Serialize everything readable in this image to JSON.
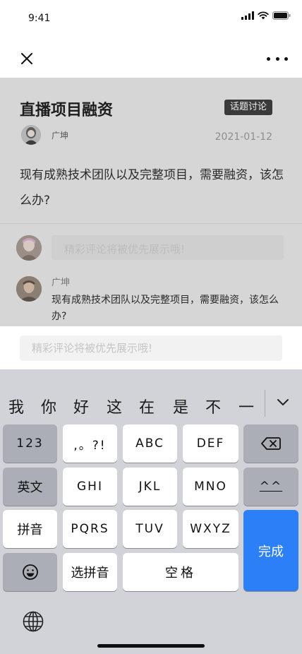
{
  "status_bar": {
    "time": "9:41"
  },
  "post": {
    "title": "直播项目融资",
    "tag": "话题讨论",
    "author": "广坤",
    "date": "2021-01-12",
    "body": "现有成熟技术团队以及完整项目，需要融资，该怎么办?"
  },
  "comments": {
    "input_placeholder": "精彩评论将被优先展示哦!",
    "items": [
      {
        "author": "广坤",
        "text": "现有成熟技术团队以及完整项目，需要融资，该怎么办?"
      }
    ]
  },
  "comment_input": {
    "placeholder": "精彩评论将被优先展示哦!"
  },
  "keyboard": {
    "candidates": [
      "我",
      "你",
      "好",
      "这",
      "在",
      "是",
      "不",
      "一"
    ],
    "keys": {
      "num": "123",
      "punct": ",。?!",
      "abc": "ABC",
      "def": "DEF",
      "english": "英文",
      "ghi": "GHI",
      "jkl": "JKL",
      "mno": "MNO",
      "caret": "^^",
      "pinyin": "拼音",
      "pqrs": "PQRS",
      "tuv": "TUV",
      "wxyz": "WXYZ",
      "done": "完成",
      "select_pinyin": "选拼音",
      "space": "空格"
    }
  },
  "colors": {
    "accent": "#2c7ff6",
    "tag_bg": "#3a3a3a",
    "overlay": "#d6d6d6"
  },
  "icons": [
    "close-icon",
    "more-icon",
    "signal-icon",
    "wifi-icon",
    "battery-icon",
    "backspace-icon",
    "emoji-icon",
    "globe-icon",
    "chevron-down-icon"
  ]
}
